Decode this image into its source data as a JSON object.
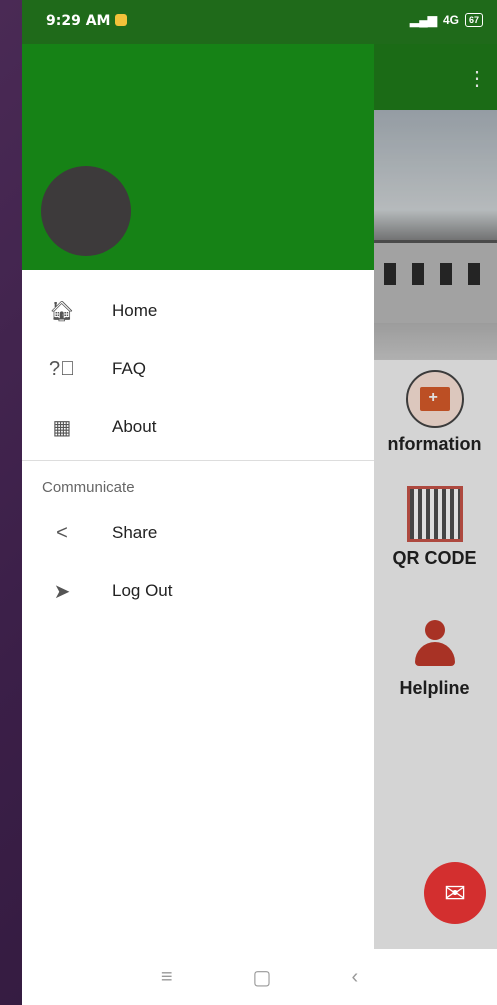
{
  "status_bar": {
    "time": "9:29 AM",
    "network": "4G",
    "battery": "67"
  },
  "drawer": {
    "items": [
      {
        "label": "Home",
        "icon": "home-icon"
      },
      {
        "label": "FAQ",
        "icon": "help-circle-icon"
      },
      {
        "label": "About",
        "icon": "grid-icon"
      }
    ],
    "section_title": "Communicate",
    "section_items": [
      {
        "label": "Share",
        "icon": "share-icon"
      },
      {
        "label": "Log Out",
        "icon": "send-icon"
      }
    ]
  },
  "background": {
    "features": [
      {
        "label": "nformation",
        "icon": "medical-folder-icon"
      },
      {
        "label": "QR CODE",
        "icon": "qr-code-icon"
      },
      {
        "label": "Helpline",
        "icon": "support-agent-icon"
      }
    ]
  },
  "colors": {
    "header_green": "#168216",
    "fab_red": "#d32f2f"
  }
}
